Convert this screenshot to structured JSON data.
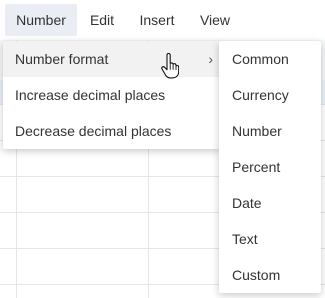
{
  "menubar": {
    "items": [
      {
        "label": "Number"
      },
      {
        "label": "Edit"
      },
      {
        "label": "Insert"
      },
      {
        "label": "View"
      }
    ]
  },
  "number_menu": {
    "items": [
      {
        "label": "Number format",
        "has_submenu": true
      },
      {
        "label": "Increase decimal places"
      },
      {
        "label": "Decrease decimal places"
      }
    ]
  },
  "number_format_submenu": {
    "items": [
      {
        "label": "Common"
      },
      {
        "label": "Currency"
      },
      {
        "label": "Number"
      },
      {
        "label": "Percent"
      },
      {
        "label": "Date"
      },
      {
        "label": "Text"
      },
      {
        "label": "Custom"
      }
    ]
  },
  "icons": {
    "submenu_arrow": "chevron-right-icon",
    "pointer": "hand-pointer-icon"
  },
  "colors": {
    "menubar_active_bg": "#eaeef4",
    "menu_hover_bg": "#f2f2f2",
    "text": "#333333"
  }
}
